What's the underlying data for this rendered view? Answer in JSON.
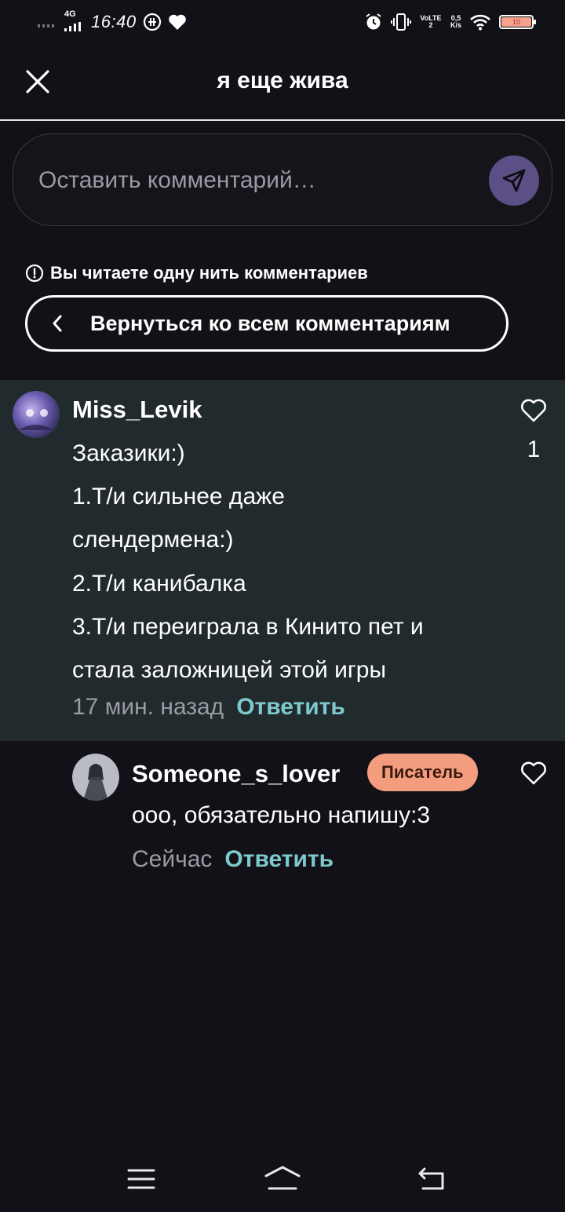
{
  "status_bar": {
    "network": "4G",
    "time": "16:40",
    "volte": "VoLTE2",
    "speed_value": "0,5",
    "speed_unit": "K/s",
    "battery": "10",
    "icons": [
      "signal-icon",
      "notification-icon",
      "heart-icon",
      "alarm-icon",
      "vibrate-icon",
      "wifi-icon",
      "battery-icon"
    ]
  },
  "header": {
    "title": "я еще жива",
    "close_icon": "close-icon"
  },
  "comment_input": {
    "placeholder": "Оставить комментарий…",
    "send_icon": "send-icon",
    "send_color": "#5c4f86"
  },
  "thread_notice": {
    "text": "Вы читаете одну нить комментариев",
    "icon": "info-icon"
  },
  "back_button": {
    "label": "Вернуться ко всем комментариям",
    "icon": "chevron-left-icon"
  },
  "main_comment": {
    "username": "Miss_Levik",
    "lines": [
      "Заказики:)",
      "1.Т/и сильнее даже",
      "слендермена:)",
      "2.Т/и канибалка",
      "3.Т/и переиграла в Кинито пет и",
      "стала заложницей этой игры"
    ],
    "time": "17 мин. назад",
    "reply_label": "Ответить",
    "likes": "1",
    "background": "#212a2c"
  },
  "reply_comment": {
    "username": "Someone_s_lover",
    "badge": "Писатель",
    "text": "ооо, обязательно напишу:3",
    "time": "Сейчас",
    "reply_label": "Ответить"
  },
  "colors": {
    "background": "#121117",
    "accent_link": "#7ec9cd",
    "badge": "#f49d7e"
  },
  "nav": {
    "icons": [
      "menu-icon",
      "home-icon",
      "back-icon"
    ]
  }
}
